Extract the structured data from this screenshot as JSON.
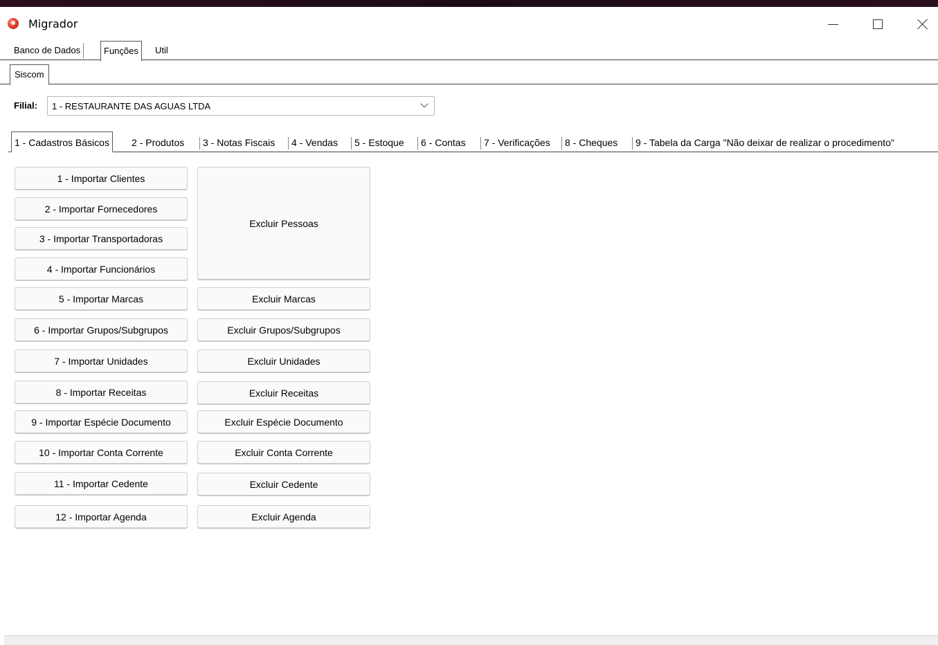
{
  "window": {
    "title": "Migrador"
  },
  "menu_tabs": [
    "Banco de Dados",
    "Funções",
    "Util"
  ],
  "sub_tabs": [
    "Siscom"
  ],
  "filial": {
    "label": "Filial:",
    "value": "1 - RESTAURANTE DAS AGUAS LTDA"
  },
  "tabs": [
    "1 - Cadastros Básicos",
    "2 - Produtos",
    "3 - Notas Fiscais",
    "4 - Vendas",
    "5 - Estoque",
    "6 - Contas",
    "7 - Verificações",
    "8 - Cheques",
    "9 - Tabela da Carga \"Não deixar de realizar o procedimento\""
  ],
  "import_buttons": [
    "1 - Importar Clientes",
    "2 - Importar Fornecedores",
    "3 - Importar Transportadoras",
    "4 - Importar Funcionários",
    "5 - Importar Marcas",
    "6 - Importar Grupos/Subgrupos",
    "7 - Importar Unidades",
    "8 - Importar Receitas",
    "9 - Importar Espécie Documento",
    "10 - Importar Conta Corrente",
    "11 - Importar Cedente",
    "12 - Importar Agenda"
  ],
  "delete_buttons": [
    "Excluir Pessoas",
    "Excluir Marcas",
    "Excluir Grupos/Subgrupos",
    "Excluir Unidades",
    "Excluir Receitas",
    "Excluir Espécie Documento",
    "Excluir Conta Corrente",
    "Excluir Cedente",
    "Excluir Agenda"
  ]
}
